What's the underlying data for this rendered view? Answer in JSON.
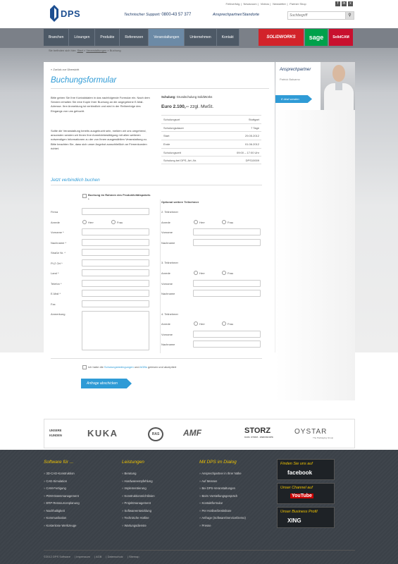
{
  "header": {
    "logo_text": "DPS",
    "top_links": [
      "Fehlverfolg",
      "Newsroom",
      "Videos",
      "Newsletter",
      "Partner Shop"
    ],
    "social": [
      "f",
      "in",
      "x"
    ],
    "support_label": "Technischer Support:",
    "support_phone": "0800-43 57 377",
    "partner_link": "Ansprechpartner/Standorte",
    "search_placeholder": "Suchbegriff"
  },
  "nav": {
    "items": [
      "Branchen",
      "Lösungen",
      "Produkte",
      "Referenzen",
      "Veranstaltungen",
      "Unternehmen",
      "Kontakt"
    ],
    "active_index": 4
  },
  "brands": {
    "solidworks": "SOLIDWORKS",
    "sage": "sage",
    "solidcam": "SolidCAM"
  },
  "breadcrumb": {
    "prefix": "Sie befinden sich hier:",
    "items": [
      "Start",
      "Veranstaltungen",
      "Buchung"
    ]
  },
  "main": {
    "back_link": "« Zurück zur Übersicht",
    "title": "Buchungsformular",
    "intro1": "Bitte geben Sie Ihre Kontaktdaten in das nachfolgende Formular ein. Nach dem Senden erhalten Sie eine Kopie Ihrer Buchung an die angegebene E-Mail-Adresse. Ihre Anmeldung ist verbindlich und wird in der Reihenfolge des Eingangs von uns gebucht.",
    "intro2": "Sollte die Veranstaltung bereits ausgebucht sein, melden wir uns umgehend, ansonsten senden wir Ihnen Ihre Anmeldebestätigung mit allen weiteren notwendigen Informationen zu der von Ihnen ausgewählten Veranstaltung zu. Bitte beachten Sie, dass sich unser Angebot ausschließlich an Firmenkunden richtet.",
    "course_label": "Schulung:",
    "course_name": "Grundschulung SolidWorks",
    "price": "Euro 2.100,--",
    "price_suffix": "zzgl. MwSt.",
    "info": [
      {
        "label": "Schulungsort",
        "value": "Stuttgart"
      },
      {
        "label": "Schulungsdauer",
        "value": "7 Tage"
      },
      {
        "label": "Start",
        "value": "29.05.2012"
      },
      {
        "label": "Ende",
        "value": "01.06.2012"
      },
      {
        "label": "Schulungszeit",
        "value": "09:00 – 17:00 Uhr"
      },
      {
        "label": "Schulung bei DPS, Art.-Nr.",
        "value": "DPS10009"
      }
    ]
  },
  "form": {
    "section_title": "Jetzt verbindlich buchen",
    "paket_label": "Buchung im Rahmen des Produktivitätspakets *",
    "fields": [
      "Firma",
      "Anrede",
      "Vorname *",
      "Nachname *",
      "Straße Nr. *",
      "PLZ Ort *",
      "Land *",
      "Telefon *",
      "E-Mail *",
      "Fax",
      "Anmerkung"
    ],
    "radio_herr": "Herr",
    "radio_frau": "Frau",
    "optional_title": "Optional weitere Teilnehmer",
    "participants": [
      "2. Teilnehmer",
      "3. Teilnehmer",
      "4. Teilnehmer"
    ],
    "p_anrede": "Anrede",
    "p_vorname": "Vorname",
    "p_nachname": "Nachname",
    "agb_pre": "Ich habe die",
    "agb_link1": "Schulungsbedingungen",
    "agb_mid": "und",
    "agb_link2": "AGBs",
    "agb_post": "gelesen und akzeptiert",
    "submit": "Anfrage abschicken"
  },
  "sidebar": {
    "title": "Ansprechpartner",
    "name": "Patrick Balsamo",
    "email_button": "E-Mail senden"
  },
  "customers": {
    "label_line1": "UNSERE",
    "label_line2": "KUNDEN",
    "kuka": "KUKA",
    "ras": "RAS",
    "amf": "AMF",
    "storz": "STORZ",
    "storz_sub": "KARL STORZ · ENDOSKOPE",
    "oystar": "OYSTAR",
    "oystar_sub": "The Packaging Group"
  },
  "footer": {
    "col1": {
      "title": "Software für ...",
      "items": [
        "3D-CAD-Konstruktion",
        "CAE-Simulation",
        "CAM-Fertigung",
        "PDM-Datenmanagement",
        "ERP-Ressourcenplanung",
        "Nachhaltigkeit",
        "Kommunikation",
        "Kostenlose Werkzeuge"
      ]
    },
    "col2": {
      "title": "Leistungen",
      "items": [
        "Beratung",
        "Hardwareempfehlung",
        "Implementierung",
        "Konstruktionsrichtlinien",
        "Projektmanagement",
        "Softwareentwicklung",
        "Technische Hotline",
        "Wartungsdienste"
      ]
    },
    "col3": {
      "title": "Mit DPS im Dialog",
      "items": [
        "Ansprechpartner in Ihrer Nähe",
        "Auf Messen",
        "Bei DPS-Veranstaltungen",
        "Beim Vorstellungsgespräch",
        "Kontaktformular",
        "Per Hotline/Deskshare",
        "Anfrage (Software/Service/Demo)",
        "Presse"
      ]
    },
    "cards": [
      {
        "title": "Finden Sie uns auf",
        "brand": "facebook"
      },
      {
        "title": "Unser Channel auf",
        "brand": "YouTube"
      },
      {
        "title": "Unser Business Profil",
        "brand": "XING"
      }
    ],
    "copyright": [
      "©2012 DPS Software",
      "Impressum",
      "AGB",
      "Datenschutz",
      "Sitemap"
    ]
  },
  "colors": {
    "accent": "#2f9bd6",
    "nav": "#4d5966",
    "footer": "#3b4148",
    "footer_heading": "#f0c400"
  }
}
